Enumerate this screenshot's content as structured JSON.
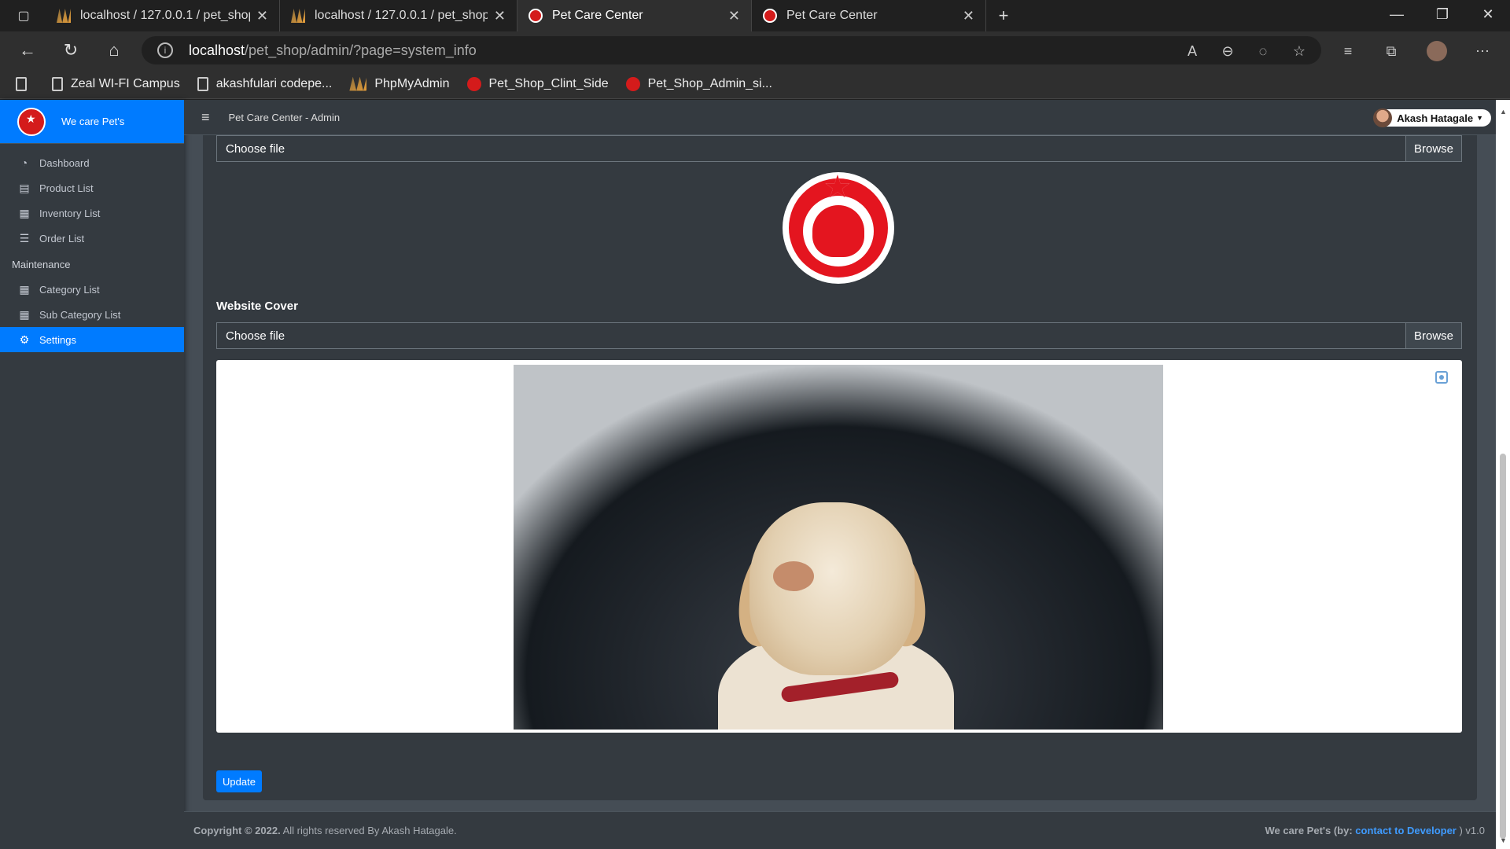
{
  "browser": {
    "tabs": [
      {
        "title": "localhost / 127.0.0.1 / pet_shop_"
      },
      {
        "title": "localhost / 127.0.0.1 / pet_shop_"
      },
      {
        "title": "Pet Care Center"
      },
      {
        "title": "Pet Care Center"
      }
    ],
    "url_host": "localhost",
    "url_path": "/pet_shop/admin/?page=system_info",
    "bookmarks": [
      {
        "label": "Zeal WI-FI Campus",
        "icon": "page-icon"
      },
      {
        "label": "akashfulari codepe...",
        "icon": "page-icon"
      },
      {
        "label": "PhpMyAdmin",
        "icon": "phpmyadmin-icon"
      },
      {
        "label": "Pet_Shop_Clint_Side",
        "icon": "pet-logo-icon"
      },
      {
        "label": "Pet_Shop_Admin_si...",
        "icon": "pet-logo-icon"
      }
    ]
  },
  "sidebar": {
    "brand": "We care Pet's",
    "items": [
      {
        "label": "Dashboard",
        "icon": "gauge-icon"
      },
      {
        "label": "Product List",
        "icon": "box-icon"
      },
      {
        "label": "Inventory List",
        "icon": "clipboard-icon"
      },
      {
        "label": "Order List",
        "icon": "list-icon"
      }
    ],
    "maintenance_header": "Maintenance",
    "maintenance_items": [
      {
        "label": "Category List",
        "icon": "table-icon"
      },
      {
        "label": "Sub Category List",
        "icon": "table-icon"
      },
      {
        "label": "Settings",
        "icon": "gears-icon",
        "active": true
      }
    ]
  },
  "topnav": {
    "title": "Pet Care Center - Admin",
    "user": "Akash Hatagale"
  },
  "form": {
    "logo_file_label": "Choose file",
    "browse_label": "Browse",
    "cover_label": "Website Cover",
    "cover_file_label": "Choose file",
    "update_label": "Update"
  },
  "footer": {
    "copyright_bold": "Copyright © 2022.",
    "copyright_rest": " All rights reserved By Akash Hatagale.",
    "right_text": "We care Pet's (by: ",
    "right_link": "contact to Developer",
    "right_end": " ) v1.0"
  },
  "colors": {
    "accent": "#007bff",
    "sidebar_bg": "#343a40",
    "content_bg": "#454d55",
    "logo_red": "#e4151f"
  }
}
